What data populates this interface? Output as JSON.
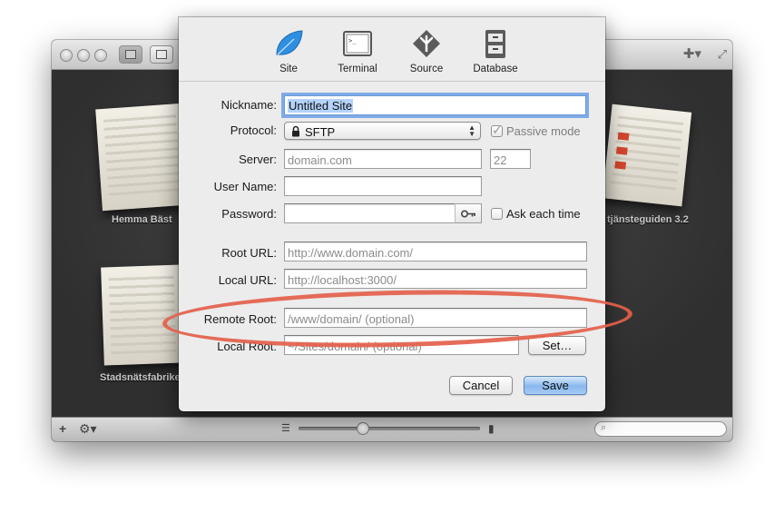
{
  "window": {
    "sites": [
      {
        "name": "Hemma Bäst"
      },
      {
        "name": "tjänsteguiden 3.2"
      },
      {
        "name": "Stadsnätsfabriken"
      }
    ],
    "zoom_level": 0.35
  },
  "dialog": {
    "tabs": [
      {
        "label": "Site",
        "icon": "leaf-icon",
        "selected": true
      },
      {
        "label": "Terminal",
        "icon": "terminal-icon",
        "selected": false
      },
      {
        "label": "Source",
        "icon": "source-icon",
        "selected": false
      },
      {
        "label": "Database",
        "icon": "database-icon",
        "selected": false
      }
    ],
    "nickname": {
      "label": "Nickname:",
      "value": "Untitled Site"
    },
    "protocol": {
      "label": "Protocol:",
      "value": "SFTP",
      "icon": "lock-icon"
    },
    "passive_mode": {
      "label": "Passive mode",
      "checked": true
    },
    "server": {
      "label": "Server:",
      "placeholder": "domain.com",
      "port_placeholder": "22"
    },
    "username": {
      "label": "User Name:",
      "value": ""
    },
    "password": {
      "label": "Password:",
      "value": "",
      "key_icon": "key-icon"
    },
    "ask_each_time": {
      "label": "Ask each time",
      "checked": false
    },
    "root_url": {
      "label": "Root URL:",
      "placeholder": "http://www.domain.com/"
    },
    "local_url": {
      "label": "Local URL:",
      "placeholder": "http://localhost:3000/"
    },
    "remote_root": {
      "label": "Remote Root:",
      "placeholder": "/www/domain/ (optional)"
    },
    "local_root": {
      "label": "Local Root:",
      "placeholder": "~/Sites/domain/ (optional)"
    },
    "set_button": "Set…",
    "cancel_button": "Cancel",
    "save_button": "Save"
  },
  "colors": {
    "annotation": "#e3604b",
    "focus_ring": "#5a96e6",
    "default_button": "#88b8ee",
    "leaf": "#2f8fe0"
  }
}
